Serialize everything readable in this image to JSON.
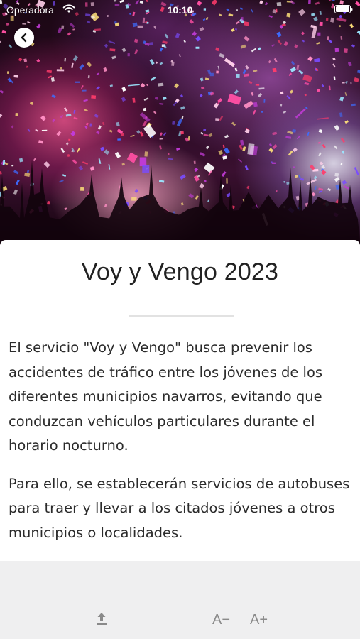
{
  "status_bar": {
    "carrier": "Operadora",
    "time": "10:10"
  },
  "header": {
    "back_icon": "chevron-left-icon",
    "image_description_icon": "confetti-concert-image"
  },
  "article": {
    "title": "Voy y Vengo 2023",
    "paragraphs": [
      "El servicio \"Voy y Vengo\" busca prevenir los accidentes de tráfico entre los jóvenes de los diferentes municipios navarros, evitando que conduzcan vehículos particulares durante el horario nocturno.",
      "Para ello, se establecerán servicios de autobuses para traer y llevar a los citados jóvenes a otros municipios o localidades."
    ]
  },
  "toolbar": {
    "share_icon": "share-upload-icon",
    "font_decrease_label": "A−",
    "font_increase_label": "A+"
  },
  "colors": {
    "card_background": "#ffffff",
    "toolbar_background": "#efeff0",
    "text": "#2b2b2b",
    "toolbar_icon": "#8a8a8a"
  }
}
